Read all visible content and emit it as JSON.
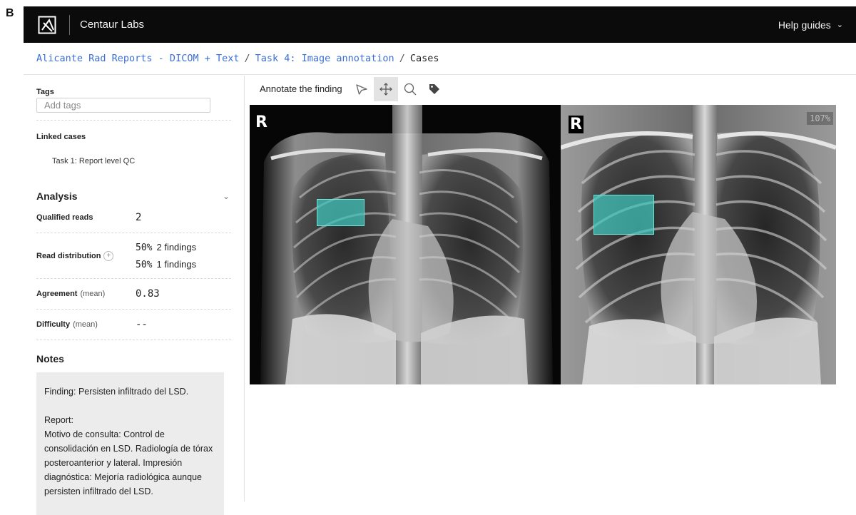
{
  "figure_label": "B",
  "app": {
    "brand": "Centaur Labs",
    "help_label": "Help guides",
    "help_chevron": "⌄"
  },
  "breadcrumb": {
    "project": "Alicante Rad Reports - DICOM + Text",
    "task": "Task 4: Image annotation",
    "current": "Cases",
    "separator": "/"
  },
  "sidebar": {
    "tags": {
      "label": "Tags",
      "placeholder": "Add tags"
    },
    "linked_cases": {
      "label": "Linked cases",
      "items": [
        "Task 1: Report level QC"
      ]
    },
    "analysis": {
      "title": "Analysis",
      "qualified_reads": {
        "label": "Qualified reads",
        "value": "2"
      },
      "read_distribution": {
        "label": "Read distribution",
        "entries": [
          {
            "pct": "50%",
            "text": "2 findings"
          },
          {
            "pct": "50%",
            "text": "1 findings"
          }
        ]
      },
      "agreement": {
        "label": "Agreement",
        "qualifier": "(mean)",
        "value": "0.83"
      },
      "difficulty": {
        "label": "Difficulty",
        "qualifier": "(mean)",
        "value": "--"
      }
    },
    "notes": {
      "title": "Notes",
      "finding": "Finding: Persisten infiltrado del LSD.",
      "report_label": "Report:",
      "report_text": "Motivo de consulta: Control de consolidación en LSD. Radiología de tórax posteroanterior y lateral. Impresión diagnóstica: Mejoría radiológica aunque persisten infiltrado del LSD."
    }
  },
  "toolbar": {
    "label": "Annotate the finding",
    "tools": [
      "pointer-icon",
      "move-icon",
      "zoom-icon",
      "tag-icon"
    ],
    "active_tool": "move-icon"
  },
  "viewer": {
    "left_image": {
      "marker": "R"
    },
    "right_image": {
      "marker": "R",
      "zoom": "107%"
    },
    "annotation_color": "#40c8be"
  }
}
